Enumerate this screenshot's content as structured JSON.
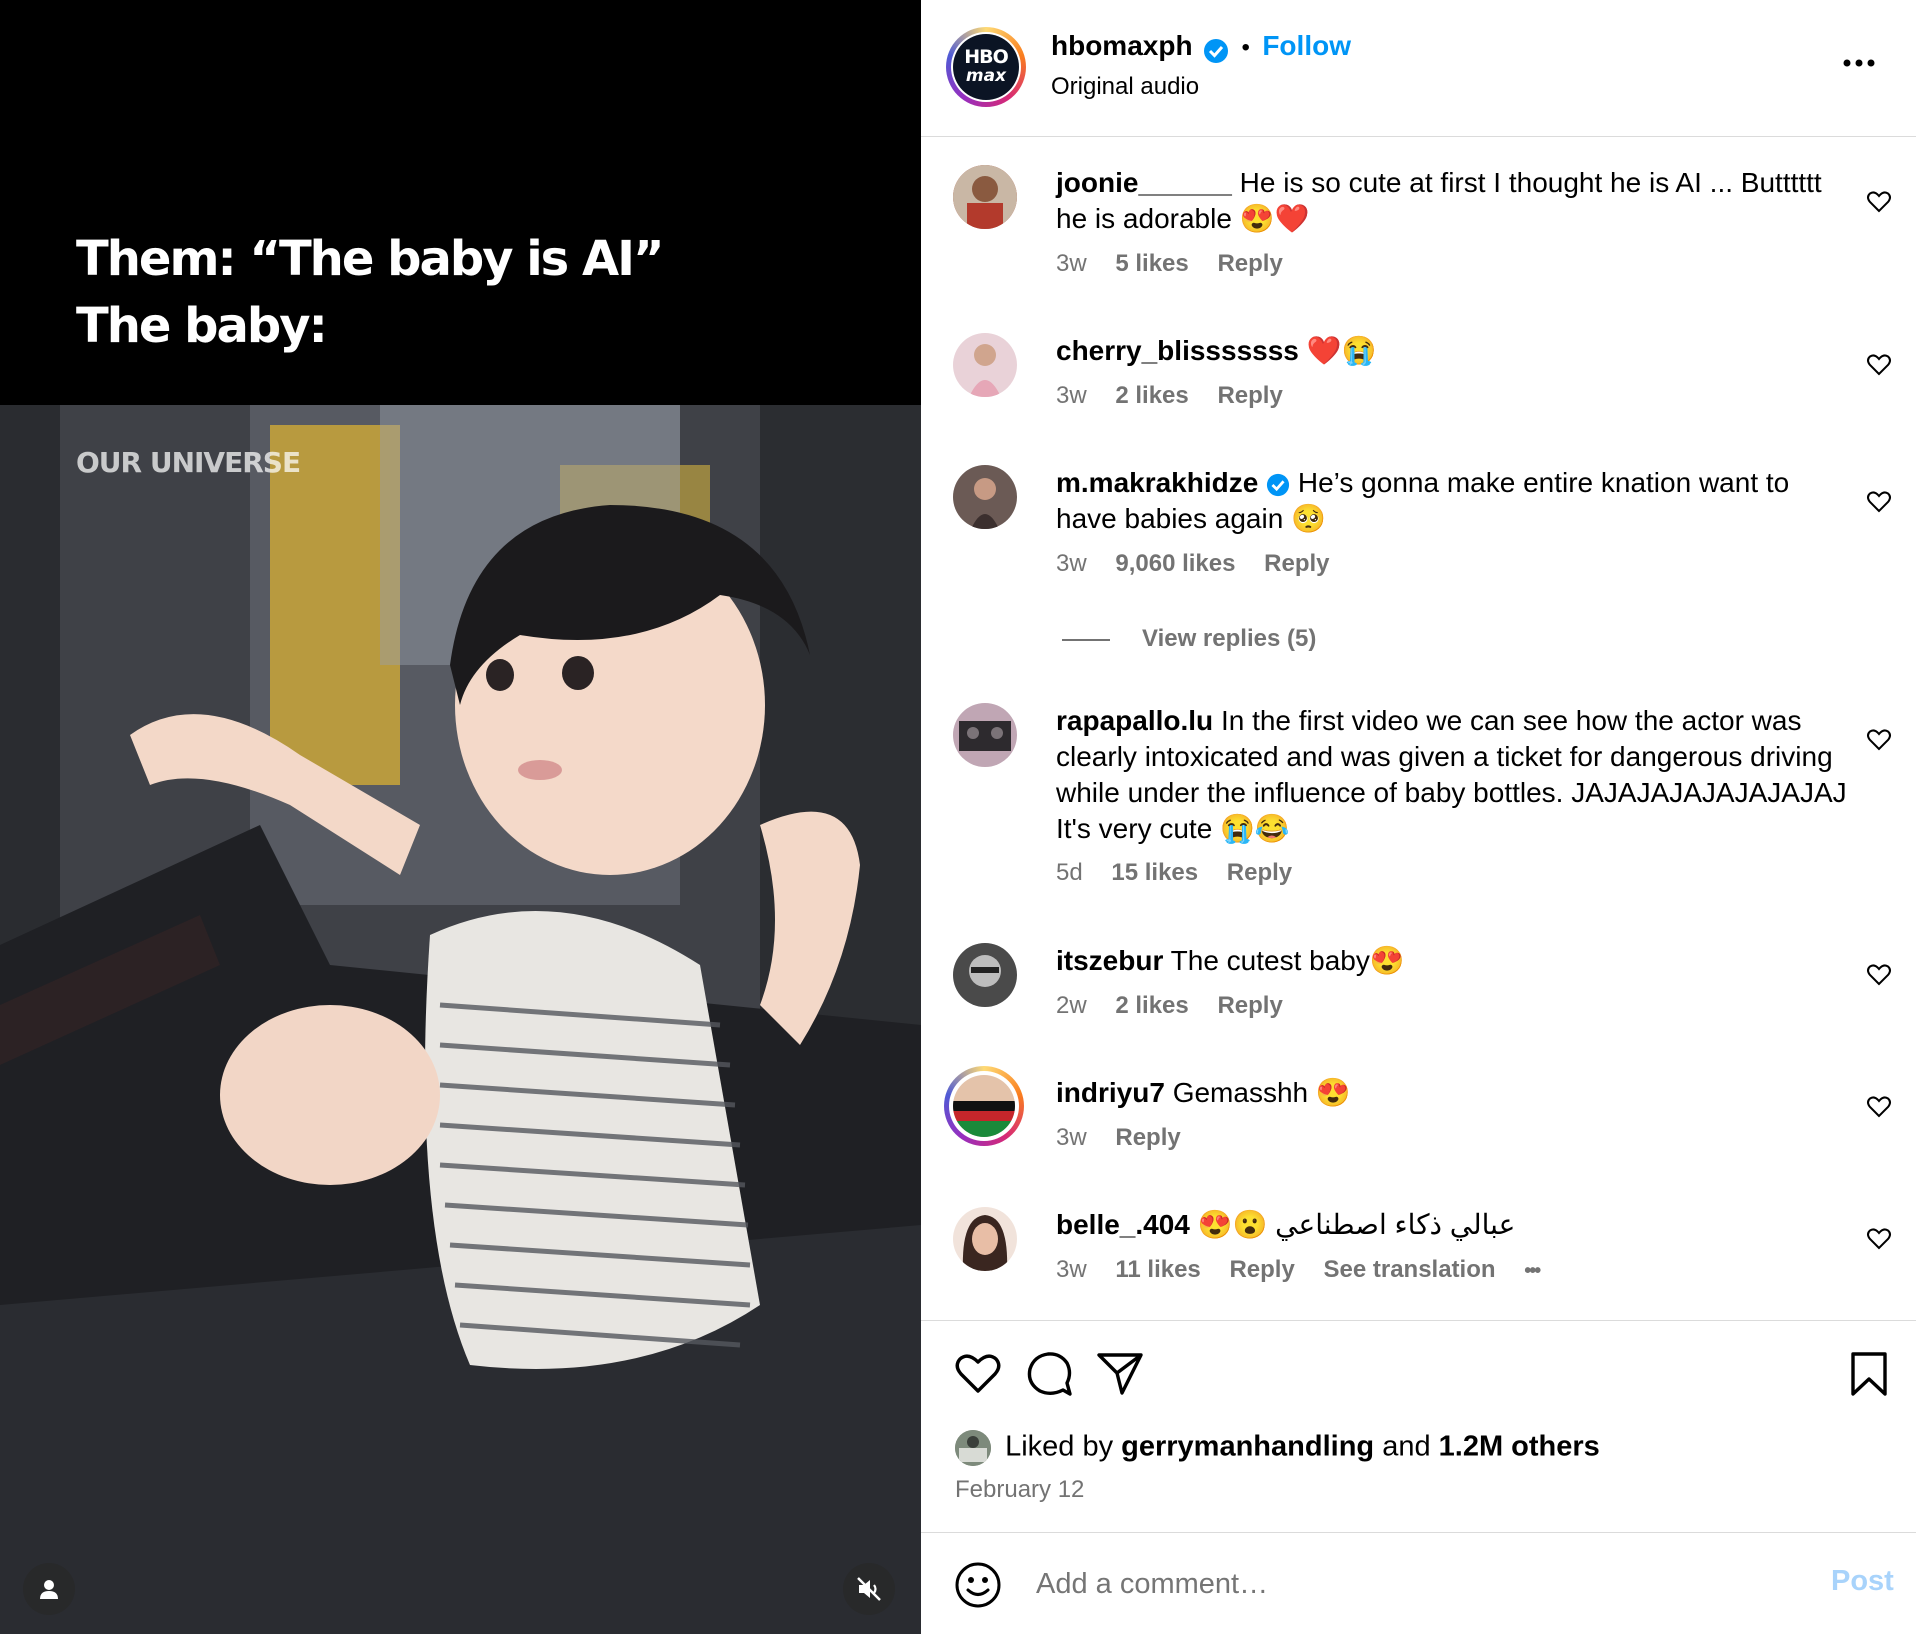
{
  "media": {
    "caption": "Them: “The baby is AI”\nThe baby:",
    "watermark": "OUR UNIVERSE",
    "user_icon": "person-icon",
    "mute_icon": "speaker-muted-icon"
  },
  "header": {
    "avatar_text_line1": "HBO",
    "avatar_text_line2": "max",
    "username": "hbomaxph",
    "separator": "•",
    "follow_label": "Follow",
    "audio": "Original audio",
    "more_icon": "more-horizontal-icon"
  },
  "comments": [
    {
      "username": "joonie______",
      "text": "He is so cute at first I thought he is AI ... Butttttt he is adorable 😍❤️",
      "time": "3w",
      "likes": "5 likes",
      "reply": "Reply"
    },
    {
      "username": "cherry_blisssssss",
      "text": "❤️😭",
      "time": "3w",
      "likes": "2 likes",
      "reply": "Reply"
    },
    {
      "username": "m.makrakhidze",
      "verified": true,
      "text": "He’s gonna make entire knation want to have babies again 🥺",
      "time": "3w",
      "likes": "9,060 likes",
      "reply": "Reply",
      "view_replies": "View replies (5)"
    },
    {
      "username": "rapapallo.lu",
      "text": "In the first video we can see how the actor was clearly intoxicated and was given a ticket for dangerous driving while under the influence of baby bottles. JAJAJAJAJAJAJAJAJ It's very cute 😭😂",
      "time": "5d",
      "likes": "15 likes",
      "reply": "Reply"
    },
    {
      "username": "itszebur",
      "text": "The cutest baby😍",
      "time": "2w",
      "likes": "2 likes",
      "reply": "Reply"
    },
    {
      "username": "indriyu7",
      "text": "Gemasshh 😍",
      "time": "3w",
      "reply": "Reply"
    },
    {
      "username": "belle_.404",
      "text": "😍😮 عبالي ذكاء اصطناعي",
      "time": "3w",
      "likes": "11 likes",
      "reply": "Reply",
      "see_translation": "See translation",
      "more": "•••"
    }
  ],
  "actions": {
    "like_icon": "heart-icon",
    "comment_icon": "comment-bubble-icon",
    "share_icon": "paper-plane-icon",
    "save_icon": "bookmark-icon"
  },
  "liked_by": {
    "prefix": "Liked by",
    "user": "gerrymanhandling",
    "and": "and",
    "others": "1.2M others"
  },
  "date": "February 12",
  "add_comment": {
    "placeholder": "Add a comment…",
    "post_label": "Post",
    "emoji_icon": "smiley-icon"
  },
  "colors": {
    "link_blue": "#0095f6",
    "post_disabled": "#a8d3fb",
    "secondary_text": "#737373",
    "divider": "#dbdbdb"
  }
}
